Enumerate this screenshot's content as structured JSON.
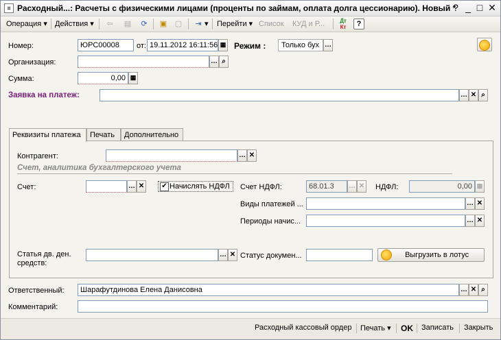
{
  "window": {
    "title": "Расходный...: Расчеты с физическими лицами (проценты по займам, оплата долга цессионарию). Новый *",
    "app_icon": "document-icon"
  },
  "toolbar": {
    "operation": "Операция",
    "actions": "Действия",
    "goto": "Перейти",
    "list": "Список",
    "kud": "КУД и Р...",
    "help": "?",
    "dtkt_dt": "Дт",
    "dtkt_kt": "Кт"
  },
  "header": {
    "number_label": "Номер:",
    "number_value": "ЮРС00008",
    "from_label": "от:",
    "date_value": "19.11.2012 16:11:56",
    "mode_label": "Режим :",
    "mode_value": "Только бух",
    "org_label": "Организация:",
    "org_value": "",
    "sum_label": "Сумма:",
    "sum_value": "0,00",
    "request_label": "Заявка на платеж:",
    "request_value": ""
  },
  "tabs": [
    "Реквизиты платежа",
    "Печать",
    "Дополнительно"
  ],
  "requisites": {
    "counterparty_label": "Контрагент:",
    "counterparty_value": "",
    "section_title": "Счет, аналитика бухгалтерского учета",
    "account_label": "Счет:",
    "account_value": "",
    "ndfl_check_label": "Начислять НДФЛ",
    "ndfl_checked": true,
    "ndfl_account_label": "Счет НДФЛ:",
    "ndfl_account_value": "68.01.3",
    "ndfl_label": "НДФЛ:",
    "ndfl_value": "0,00",
    "payment_types_label": "Виды платежей ...",
    "payment_types_value": "",
    "periods_label": "Периоды начис...",
    "periods_value": "",
    "cashflow_label_1": "Статья дв. ден.",
    "cashflow_label_2": "средств:",
    "cashflow_value": "",
    "doc_status_label": "Статус докумен...",
    "doc_status_value": "",
    "export_button": "Выгрузить в лотус"
  },
  "footer_fields": {
    "responsible_label": "Ответственный:",
    "responsible_value": "Шарафутдинова Елена Данисовна",
    "comment_label": "Комментарий:",
    "comment_value": ""
  },
  "bottombar": {
    "cash_order": "Расходный кассовый ордер",
    "print": "Печать",
    "ok": "OK",
    "save": "Записать",
    "close": "Закрыть"
  }
}
